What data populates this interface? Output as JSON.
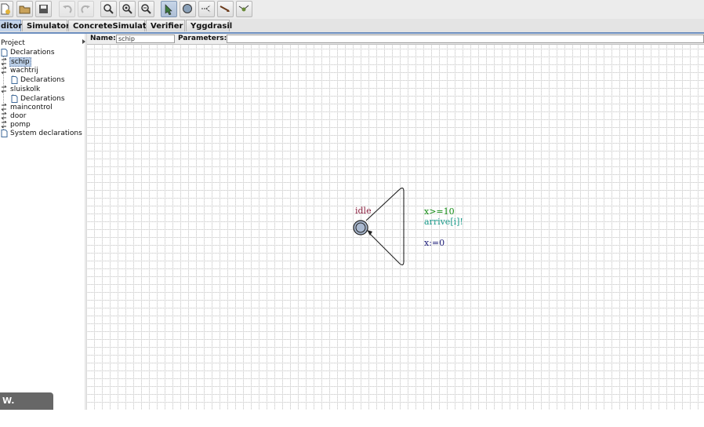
{
  "toolbar": {
    "buttons": [
      {
        "icon": "new-document-icon"
      },
      {
        "icon": "open-folder-icon"
      },
      {
        "icon": "save-icon"
      },
      {
        "icon": "undo-icon"
      },
      {
        "icon": "redo-icon"
      },
      {
        "icon": "zoom-in-icon"
      },
      {
        "icon": "zoom-fit-icon"
      },
      {
        "icon": "zoom-out-icon"
      },
      {
        "icon": "select-tool-icon"
      },
      {
        "icon": "add-location-tool-icon"
      },
      {
        "icon": "add-branch-tool-icon"
      },
      {
        "icon": "add-edge-tool-icon"
      },
      {
        "icon": "add-nail-tool-icon"
      }
    ]
  },
  "tabs": [
    "ditor",
    "Simulator",
    "ConcreteSimulator",
    "Verifier",
    "Yggdrasil"
  ],
  "tree": {
    "root": "Project",
    "items": [
      "Declarations",
      "schip",
      "wachtrij",
      "Declarations",
      "sluiskolk",
      "Declarations",
      "maincontrol",
      "door",
      "pomp",
      "System declarations"
    ]
  },
  "editor": {
    "name_label": "Name:",
    "name_value": "schip",
    "params_label": "Parameters:",
    "params_value": ""
  },
  "automaton": {
    "location_name": "idle",
    "guard": "x>=10",
    "sync": "arrive[i]!",
    "update": "x:=0",
    "colors": {
      "location_name": "#8a1f3e",
      "guard": "#138a13",
      "sync": "#1a9a8a",
      "update": "#20207a"
    }
  },
  "caption": "W. (Wessel)"
}
